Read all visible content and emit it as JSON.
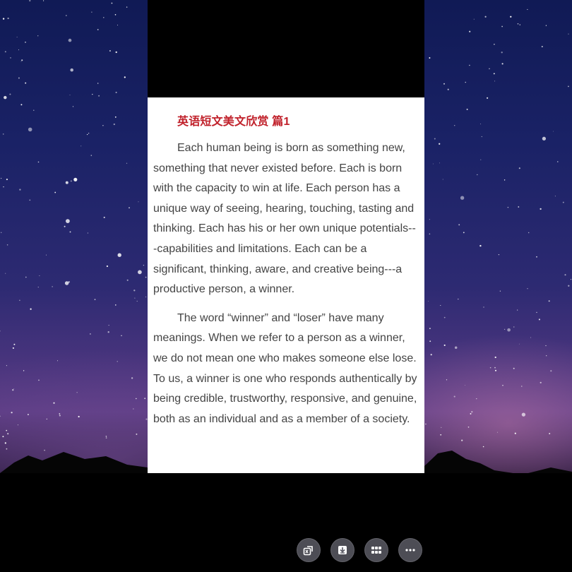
{
  "document": {
    "title": "英语短文美文欣赏 篇1",
    "paragraphs": [
      "Each human being is born as something new, something that never existed before. Each is born with the capacity to win at life. Each person has a unique way of seeing, hearing, touching, tasting and thinking. Each has his or her own unique potentials---capabilities and limitations. Each can be a significant, thinking, aware, and creative being---a productive person, a winner.",
      "The word “winner” and “loser” have many meanings. When we refer to a person as a winner, we do not mean one who makes someone else lose. To us, a winner is one who responds authentically by being credible, trustworthy, responsive, and genuine, both as an individual and as a member of a society."
    ],
    "title_color": "#c0202a"
  },
  "toolbar": {
    "buttons": [
      {
        "icon": "export-icon"
      },
      {
        "icon": "download-icon"
      },
      {
        "icon": "grid-icon"
      },
      {
        "icon": "more-icon"
      }
    ]
  }
}
